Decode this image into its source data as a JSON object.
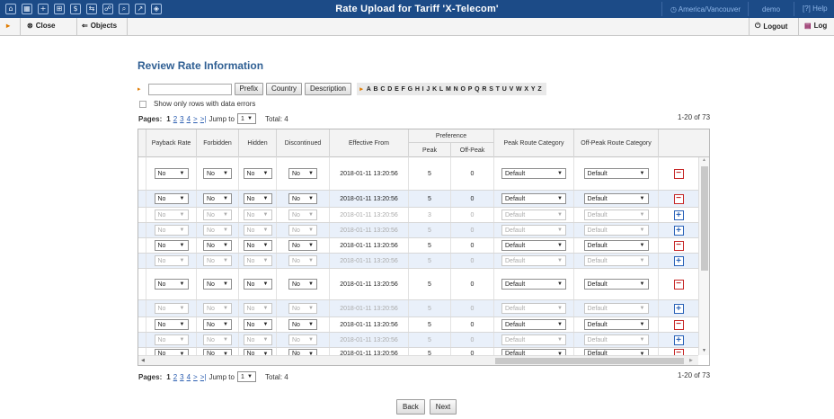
{
  "window": {
    "title": "Rate Upload for Tariff 'X-Telecom'",
    "timezone": "America/Vancouver",
    "user": "demo",
    "help": "Help"
  },
  "toolbar": {
    "close_label": "Close",
    "objects_label": "Objects",
    "logout_label": "Logout",
    "log_label": "Log"
  },
  "page": {
    "heading": "Review Rate Information"
  },
  "filter": {
    "search_value": "",
    "prefix_label": "Prefix",
    "country_label": "Country",
    "description_label": "Description",
    "letters": [
      "A",
      "B",
      "C",
      "D",
      "E",
      "F",
      "G",
      "H",
      "I",
      "J",
      "K",
      "L",
      "M",
      "N",
      "O",
      "P",
      "Q",
      "R",
      "S",
      "T",
      "U",
      "V",
      "W",
      "X",
      "Y",
      "Z"
    ],
    "errors_only_label": "Show only rows with data errors"
  },
  "pagination": {
    "label": "Pages:",
    "current": "1",
    "pages": [
      "2",
      "3",
      "4"
    ],
    "next": ">",
    "last": ">|",
    "jump_label": "Jump to",
    "jump_value": "1",
    "total": "Total: 4",
    "range": "1-20 of 73"
  },
  "table": {
    "columns": [
      "Payback Rate",
      "Forbidden",
      "Hidden",
      "Discontinued",
      "Effective From",
      "Preference",
      "Peak",
      "Off-Peak",
      "Peak Route Category",
      "Off-Peak Route Category"
    ],
    "rows": [
      {
        "payback": "No",
        "forbidden": "No",
        "hidden": "No",
        "discontinued": "No",
        "effective": "2018-01-11 13:20:56",
        "peak": "5",
        "offpeak": "0",
        "peak_cat": "Default",
        "offpeak_cat": "Default",
        "action": "remove",
        "disabled": false
      },
      {
        "payback": "No",
        "forbidden": "No",
        "hidden": "No",
        "discontinued": "No",
        "effective": "2018-01-11 13:20:56",
        "peak": "5",
        "offpeak": "0",
        "peak_cat": "Default",
        "offpeak_cat": "Default",
        "action": "remove",
        "disabled": false
      },
      {
        "payback": "No",
        "forbidden": "No",
        "hidden": "No",
        "discontinued": "No",
        "effective": "2018-01-11 13:20:56",
        "peak": "3",
        "offpeak": "0",
        "peak_cat": "Default",
        "offpeak_cat": "Default",
        "action": "add",
        "disabled": true
      },
      {
        "payback": "No",
        "forbidden": "No",
        "hidden": "No",
        "discontinued": "No",
        "effective": "2018-01-11 13:20:56",
        "peak": "5",
        "offpeak": "0",
        "peak_cat": "Default",
        "offpeak_cat": "Default",
        "action": "add",
        "disabled": true
      },
      {
        "payback": "No",
        "forbidden": "No",
        "hidden": "No",
        "discontinued": "No",
        "effective": "2018-01-11 13:20:56",
        "peak": "5",
        "offpeak": "0",
        "peak_cat": "Default",
        "offpeak_cat": "Default",
        "action": "remove",
        "disabled": false
      },
      {
        "payback": "No",
        "forbidden": "No",
        "hidden": "No",
        "discontinued": "No",
        "effective": "2018-01-11 13:20:56",
        "peak": "5",
        "offpeak": "0",
        "peak_cat": "Default",
        "offpeak_cat": "Default",
        "action": "add",
        "disabled": true
      },
      {
        "payback": "No",
        "forbidden": "No",
        "hidden": "No",
        "discontinued": "No",
        "effective": "2018-01-11 13:20:56",
        "peak": "5",
        "offpeak": "0",
        "peak_cat": "Default",
        "offpeak_cat": "Default",
        "action": "remove",
        "disabled": false
      },
      {
        "payback": "No",
        "forbidden": "No",
        "hidden": "No",
        "discontinued": "No",
        "effective": "2018-01-11 13:20:56",
        "peak": "5",
        "offpeak": "0",
        "peak_cat": "Default",
        "offpeak_cat": "Default",
        "action": "add",
        "disabled": true
      },
      {
        "payback": "No",
        "forbidden": "No",
        "hidden": "No",
        "discontinued": "No",
        "effective": "2018-01-11 13:20:56",
        "peak": "5",
        "offpeak": "0",
        "peak_cat": "Default",
        "offpeak_cat": "Default",
        "action": "remove",
        "disabled": false
      },
      {
        "payback": "No",
        "forbidden": "No",
        "hidden": "No",
        "discontinued": "No",
        "effective": "2018-01-11 13:20:56",
        "peak": "5",
        "offpeak": "0",
        "peak_cat": "Default",
        "offpeak_cat": "Default",
        "action": "add",
        "disabled": true
      },
      {
        "payback": "No",
        "forbidden": "No",
        "hidden": "No",
        "discontinued": "No",
        "effective": "2018-01-11 13:20:56",
        "peak": "5",
        "offpeak": "0",
        "peak_cat": "Default",
        "offpeak_cat": "Default",
        "action": "remove",
        "disabled": false
      }
    ]
  },
  "footer": {
    "back_label": "Back",
    "next_label": "Next"
  },
  "colors": {
    "topbar": "#1c4b87",
    "heading": "#2f5f93",
    "remove": "#c62828",
    "add": "#2b63b8"
  }
}
